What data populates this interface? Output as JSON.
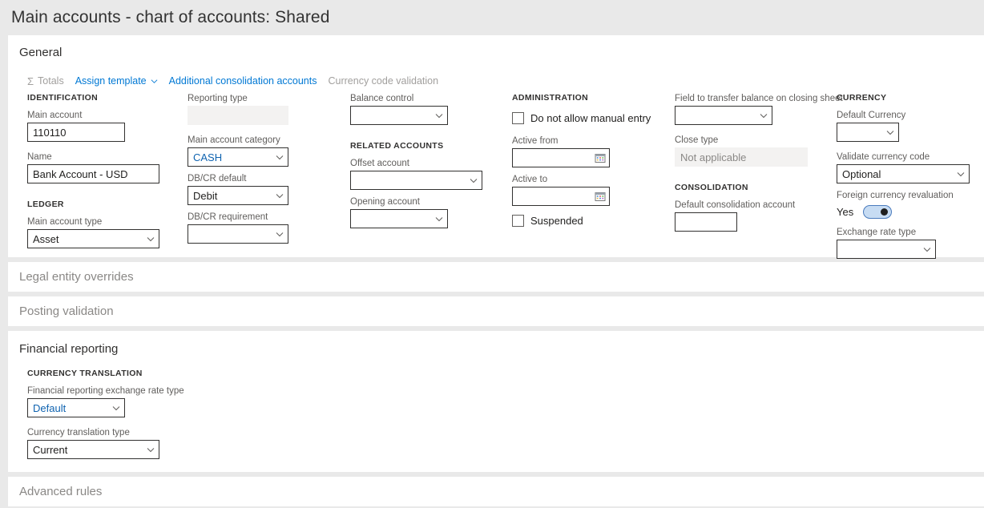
{
  "header": {
    "title": "Main accounts - chart of accounts: Shared"
  },
  "sections": {
    "general": {
      "title": "General"
    },
    "legal_entity_overrides": {
      "title": "Legal entity overrides"
    },
    "posting_validation": {
      "title": "Posting validation"
    },
    "financial_reporting": {
      "title": "Financial reporting"
    },
    "advanced_rules": {
      "title": "Advanced rules"
    }
  },
  "toolbar": {
    "totals": "Totals",
    "totals_icon": "sigma-icon",
    "assign_template": "Assign template",
    "assign_template_caret": "chevron-down-icon",
    "additional_consolidation_accounts": "Additional consolidation accounts",
    "currency_code_validation": "Currency code validation"
  },
  "groups": {
    "identification": "IDENTIFICATION",
    "ledger": "LEDGER",
    "related_accounts": "RELATED ACCOUNTS",
    "administration": "ADMINISTRATION",
    "consolidation": "CONSOLIDATION",
    "currency": "CURRENCY",
    "currency_translation": "CURRENCY TRANSLATION"
  },
  "fields": {
    "main_account": {
      "label": "Main account",
      "value": "110110"
    },
    "name": {
      "label": "Name",
      "value": "Bank Account - USD"
    },
    "main_account_type": {
      "label": "Main account type",
      "value": "Asset"
    },
    "reporting_type": {
      "label": "Reporting type",
      "value": ""
    },
    "main_account_category": {
      "label": "Main account category",
      "value": "CASH"
    },
    "dbcr_default": {
      "label": "DB/CR default",
      "value": "Debit"
    },
    "dbcr_requirement": {
      "label": "DB/CR requirement",
      "value": ""
    },
    "balance_control": {
      "label": "Balance control",
      "value": ""
    },
    "offset_account": {
      "label": "Offset account",
      "value": ""
    },
    "opening_account": {
      "label": "Opening account",
      "value": ""
    },
    "do_not_allow_manual_entry": {
      "label": "Do not allow manual entry",
      "checked": false
    },
    "active_from": {
      "label": "Active from",
      "value": ""
    },
    "active_to": {
      "label": "Active to",
      "value": ""
    },
    "suspended": {
      "label": "Suspended",
      "checked": false
    },
    "field_to_transfer_balance": {
      "label": "Field to transfer balance on closing sheet",
      "value": ""
    },
    "close_type": {
      "label": "Close type",
      "value": "Not applicable"
    },
    "default_consolidation_account": {
      "label": "Default consolidation account",
      "value": ""
    },
    "default_currency": {
      "label": "Default Currency",
      "value": ""
    },
    "validate_currency_code": {
      "label": "Validate currency code",
      "value": "Optional"
    },
    "foreign_currency_revaluation": {
      "label": "Foreign currency revaluation",
      "value": "Yes",
      "on": true
    },
    "exchange_rate_type": {
      "label": "Exchange rate type",
      "value": ""
    },
    "financial_reporting_exchange_rate_type": {
      "label": "Financial reporting exchange rate type",
      "value": "Default"
    },
    "currency_translation_type": {
      "label": "Currency translation type",
      "value": "Current"
    }
  },
  "colors": {
    "accent": "#0078d4",
    "link": "#0f63b0",
    "page_bg": "#e9e9e9",
    "panel_bg": "#ffffff",
    "text": "#201f1e",
    "label": "#605e5c",
    "disabled": "#8a8886",
    "toggle_on_fill": "#c7dcf3",
    "toggle_on_border": "#4a7bbd"
  }
}
